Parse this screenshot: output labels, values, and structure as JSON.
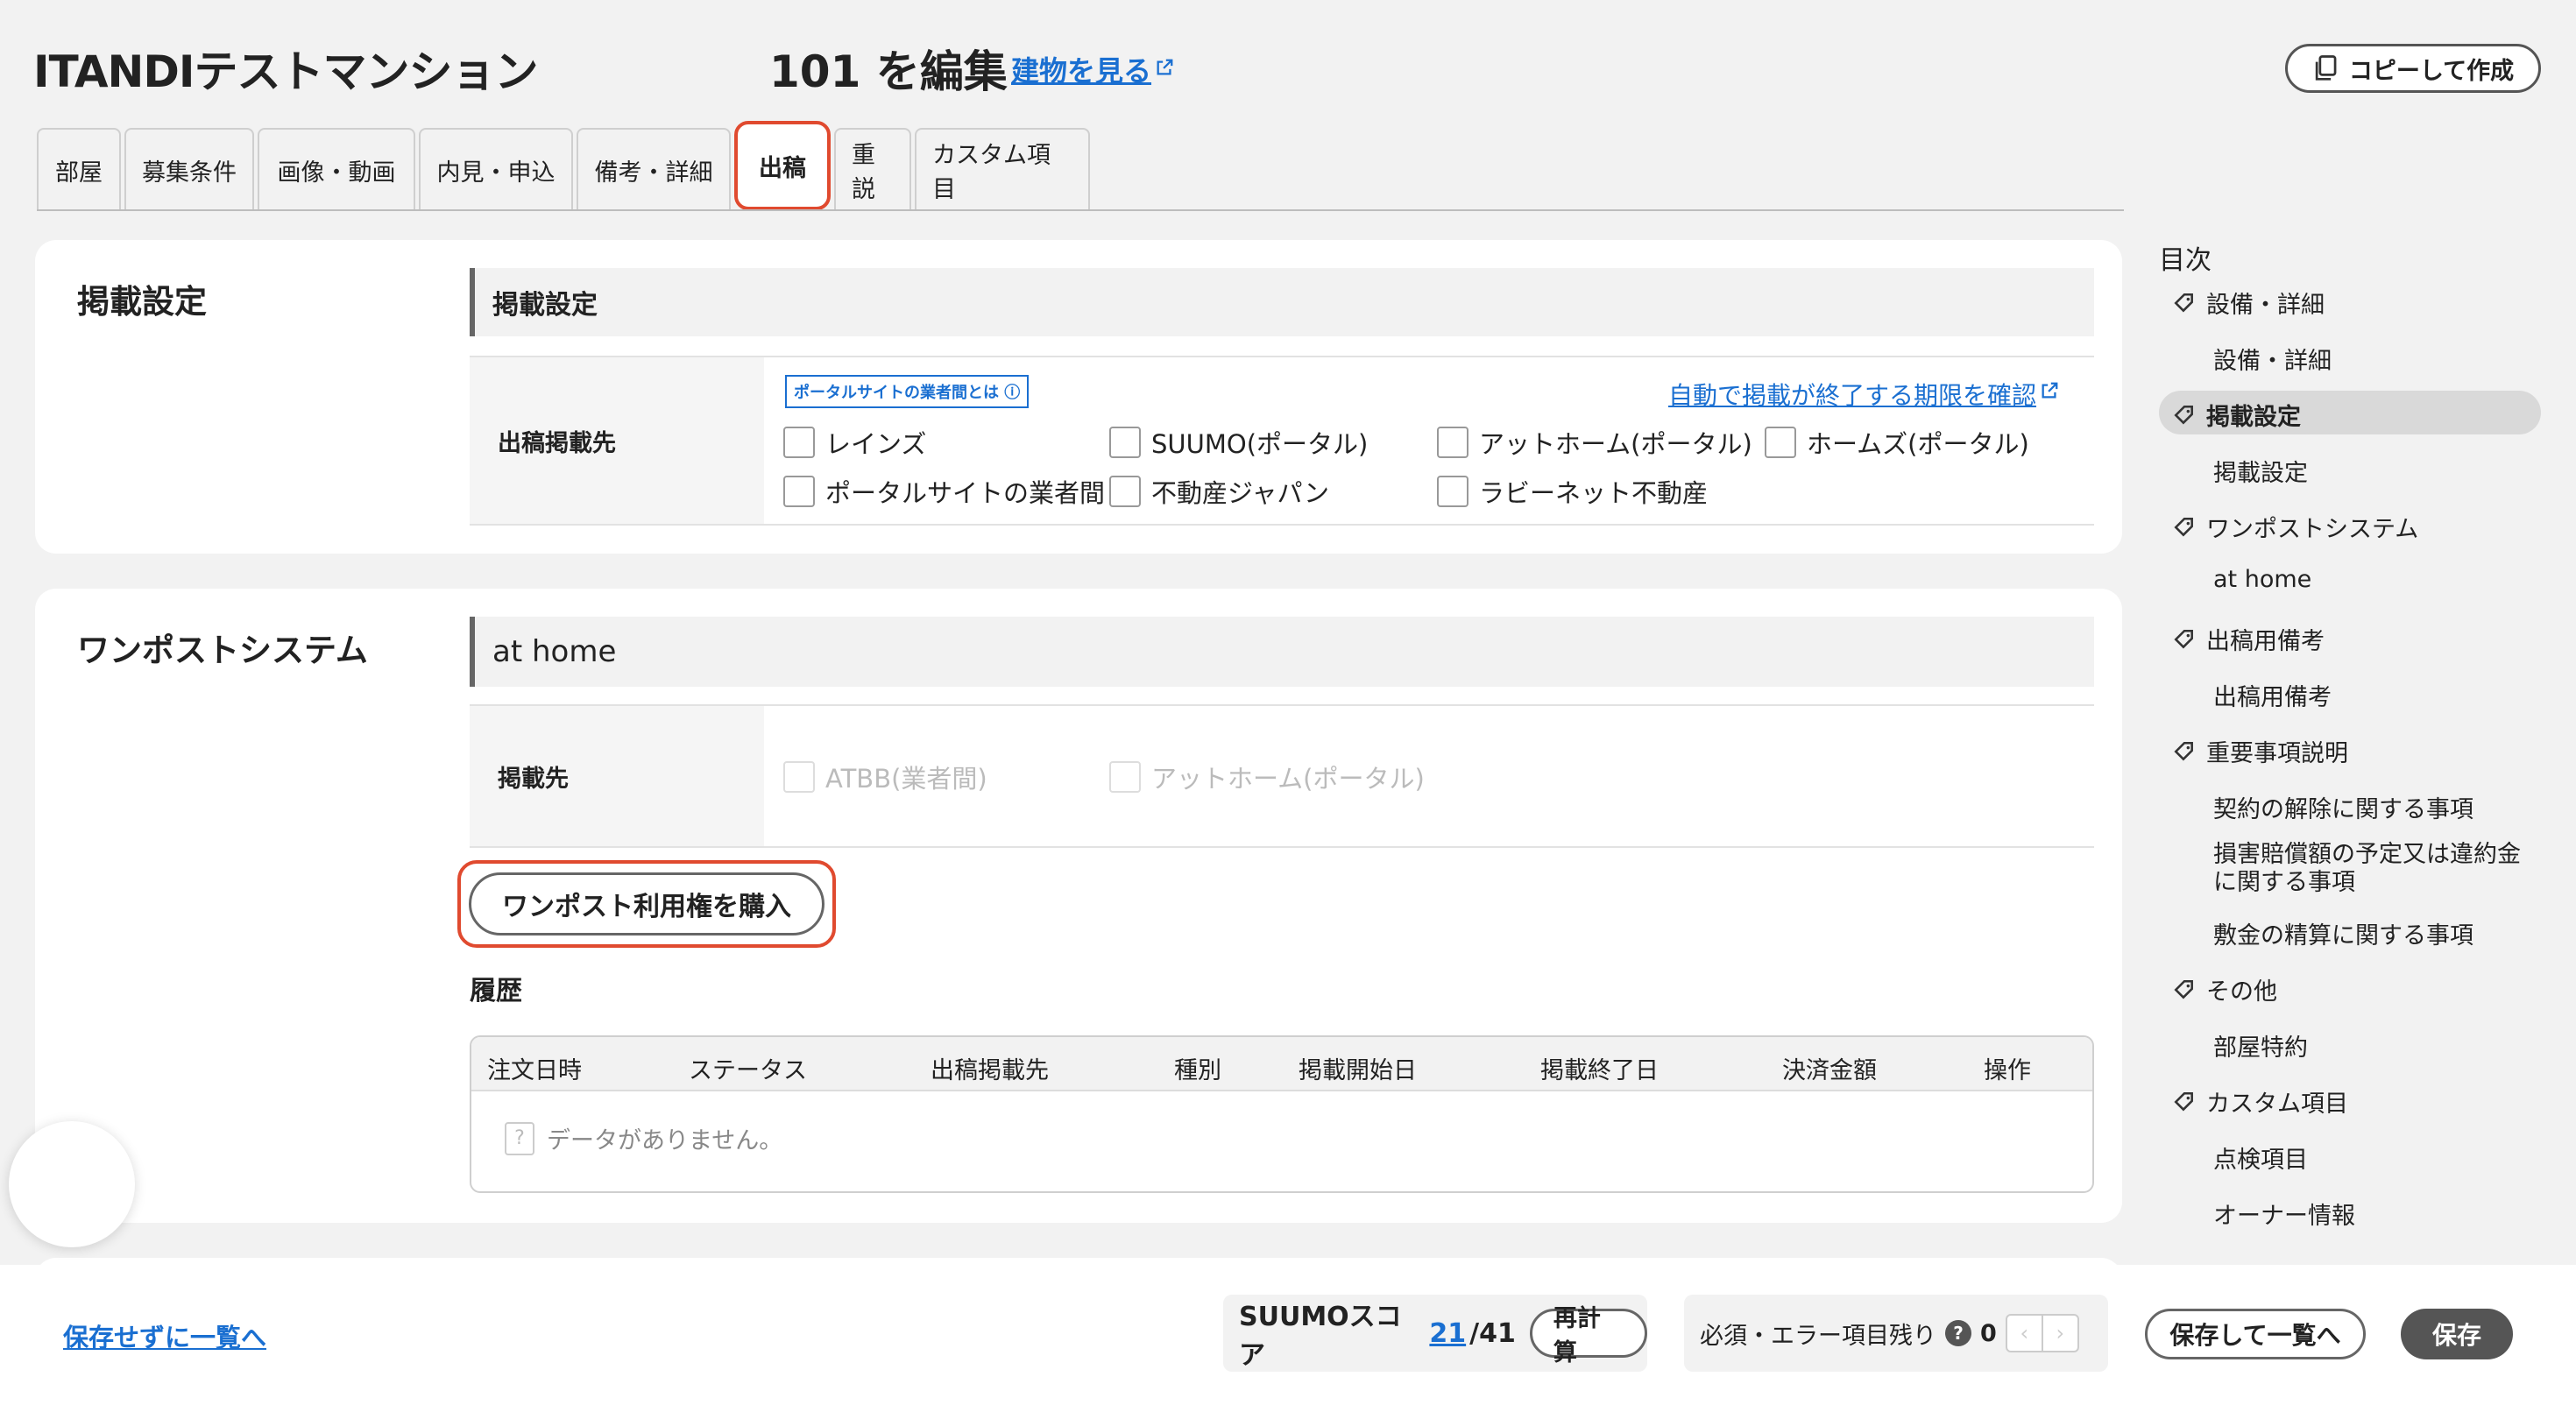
{
  "header": {
    "app_title": "ITANDIテストマンション",
    "edit_title": "101 を編集",
    "building_link": "建物を見る",
    "copy_button": "コピーして作成"
  },
  "tabs": [
    {
      "label": "部屋"
    },
    {
      "label": "募集条件"
    },
    {
      "label": "画像・動画"
    },
    {
      "label": "内見・申込"
    },
    {
      "label": "備考・詳細"
    },
    {
      "label": "出稿",
      "active": true
    },
    {
      "label": "重説"
    },
    {
      "label": "カスタム項目"
    }
  ],
  "listing_settings": {
    "title": "掲載設定",
    "sub_header": "掲載設定",
    "row_label": "出稿掲載先",
    "portal_badge": "ポータルサイトの業者間とは",
    "auto_end_link": "自動で掲載が終了する期限を確認",
    "options": [
      "レインズ",
      "SUUMO(ポータル)",
      "アットホーム(ポータル)",
      "ホームズ(ポータル)",
      "ポータルサイトの業者間",
      "不動産ジャパン",
      "ラビーネット不動産"
    ]
  },
  "onepost": {
    "title": "ワンポストシステム",
    "sub_header": "at home",
    "row_label": "掲載先",
    "options": [
      "ATBB(業者間)",
      "アットホーム(ポータル)"
    ],
    "buy_button": "ワンポスト利用権を購入",
    "history_title": "履歴",
    "history_columns": [
      "注文日時",
      "ステータス",
      "出稿掲載先",
      "種別",
      "掲載開始日",
      "掲載終了日",
      "決済金額",
      "操作"
    ],
    "empty_text": "データがありません。"
  },
  "toc": {
    "title": "目次",
    "items": [
      {
        "label": "設備・詳細",
        "type": "section"
      },
      {
        "label": "設備・詳細",
        "type": "child"
      },
      {
        "label": "掲載設定",
        "type": "section",
        "active": true
      },
      {
        "label": "掲載設定",
        "type": "child"
      },
      {
        "label": "ワンポストシステム",
        "type": "section"
      },
      {
        "label": "at home",
        "type": "child"
      },
      {
        "label": "出稿用備考",
        "type": "section"
      },
      {
        "label": "出稿用備考",
        "type": "child"
      },
      {
        "label": "重要事項説明",
        "type": "section"
      },
      {
        "label": "契約の解除に関する事項",
        "type": "child"
      },
      {
        "label": "損害賠償額の予定又は違約金に関する事項",
        "type": "child"
      },
      {
        "label": "敷金の精算に関する事項",
        "type": "child"
      },
      {
        "label": "その他",
        "type": "section"
      },
      {
        "label": "部屋特約",
        "type": "child"
      },
      {
        "label": "カスタム項目",
        "type": "section"
      },
      {
        "label": "点検項目",
        "type": "child"
      },
      {
        "label": "オーナー情報",
        "type": "child"
      }
    ]
  },
  "footer": {
    "leave_link": "保存せずに一覧へ",
    "score_label": "SUUMOスコア",
    "score_value": "21",
    "score_total": "/41",
    "recalc_button": "再計算",
    "remaining_label": "必須・エラー項目残り",
    "remaining_count": "0",
    "save_list_button": "保存して一覧へ",
    "save_button": "保存"
  },
  "colors": {
    "accent_red": "#e04a2f",
    "link_blue": "#1a6fd1",
    "dark_button": "#555555"
  }
}
